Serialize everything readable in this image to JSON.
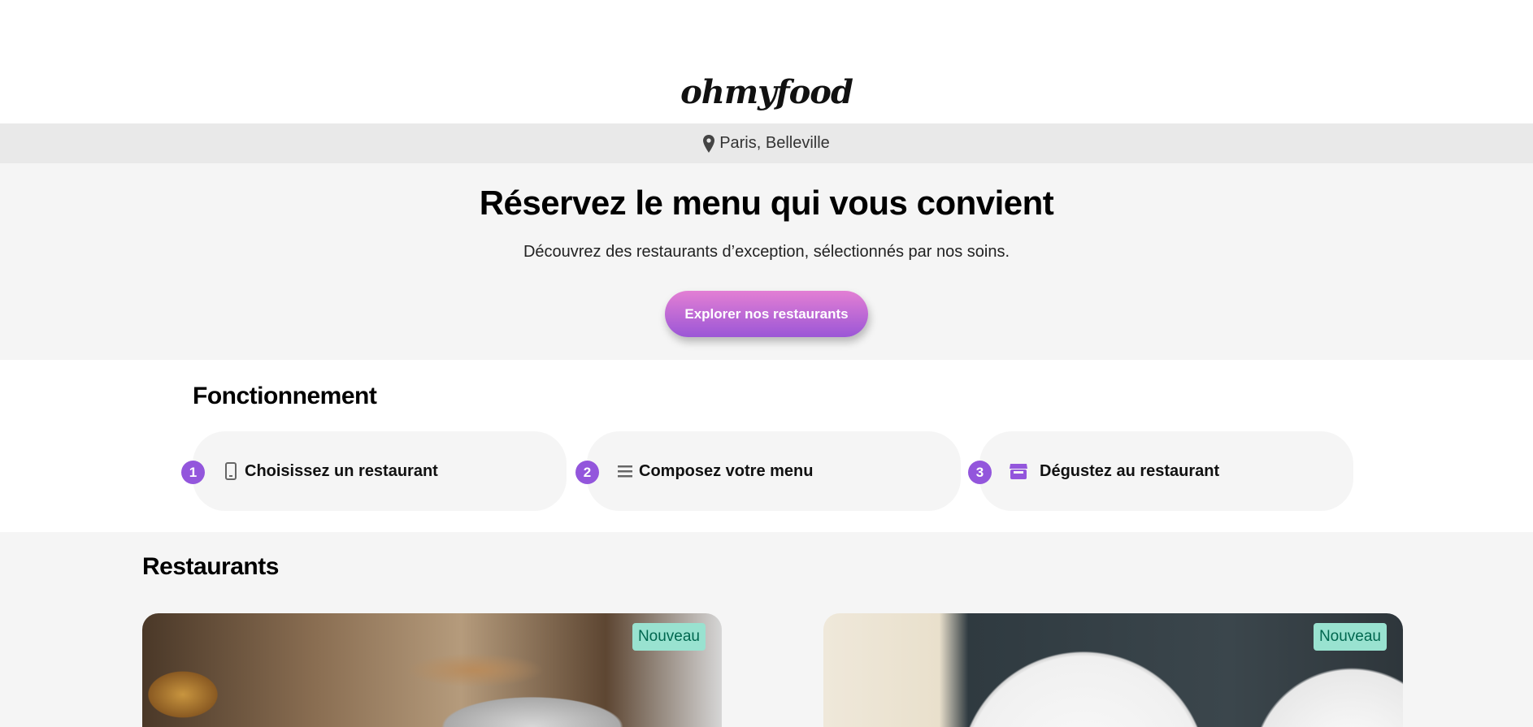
{
  "header": {
    "logo": "ohmyfood"
  },
  "location": {
    "icon": "map-pin-icon",
    "label": "Paris, Belleville"
  },
  "hero": {
    "title": "Réservez le menu qui vous convient",
    "subtitle": "Découvrez des restaurants d’exception, sélectionnés par nos soins.",
    "cta_label": "Explorer nos restaurants"
  },
  "how_it_works": {
    "title": "Fonctionnement",
    "steps": [
      {
        "number": "1",
        "icon": "mobile-phone-icon",
        "label": "Choisissez un restaurant"
      },
      {
        "number": "2",
        "icon": "list-icon",
        "label": "Composez votre menu"
      },
      {
        "number": "3",
        "icon": "store-icon",
        "label": "Dégustez au restaurant"
      }
    ]
  },
  "restaurants": {
    "title": "Restaurants",
    "cards": [
      {
        "badge": "Nouveau"
      },
      {
        "badge": "Nouveau"
      }
    ]
  },
  "colors": {
    "accent": "#9356dc",
    "badge_bg": "#99e2d0",
    "badge_text": "#00674f"
  }
}
